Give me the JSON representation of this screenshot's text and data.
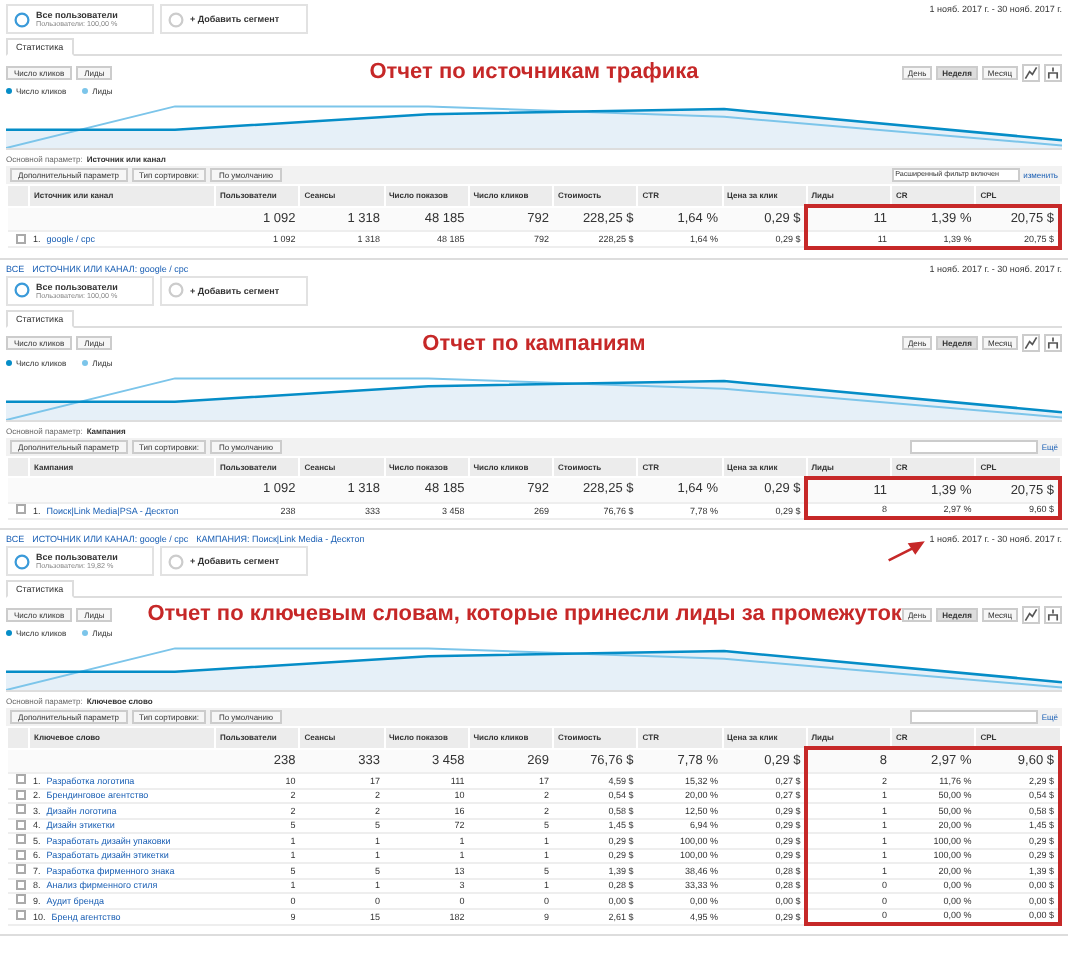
{
  "panels": [
    {
      "segments": [
        {
          "kind": "segment",
          "name": "Все пользователи",
          "sub": "Пользователи: 100,00 %"
        },
        {
          "kind": "add",
          "name": "+ Добавить сегмент"
        }
      ],
      "date": "1 нояб. 2017 г. - 30 нояб. 2017 г.",
      "tabs": [
        {
          "label": "Статистика",
          "selected": true
        }
      ],
      "metrics": [
        "Число кликов",
        "Лиды"
      ],
      "title": "Отчет по источникам трафика",
      "periods": [
        {
          "label": "День",
          "selected": false
        },
        {
          "label": "Неделя",
          "selected": true
        },
        {
          "label": "Месяц",
          "selected": false
        }
      ],
      "legend": [
        {
          "label": "Число кликов",
          "color": "#058dc7"
        },
        {
          "label": "Лиды",
          "color": "#7cc5ea"
        }
      ],
      "primary": {
        "label": "Основной параметр:",
        "value": "Источник или канал"
      },
      "toolbar": [
        "Дополнительный параметр",
        "Тип сортировки:",
        "По умолчанию"
      ],
      "search": {
        "value": "Расширенный фильтр включен"
      },
      "search_link": "изменить",
      "columns": [
        {
          "label": "Источник или канал",
          "highlighted": false
        },
        {
          "label": "Пользователи",
          "highlighted": false
        },
        {
          "label": "Сеансы",
          "highlighted": false
        },
        {
          "label": "Число показов",
          "highlighted": false
        },
        {
          "label": "Число кликов",
          "highlighted": false
        },
        {
          "label": "Стоимость",
          "highlighted": false
        },
        {
          "label": "CTR",
          "highlighted": false
        },
        {
          "label": "Цена за клик",
          "highlighted": false
        },
        {
          "label": "Лиды",
          "highlighted": true
        },
        {
          "label": "CR",
          "highlighted": true
        },
        {
          "label": "CPL",
          "highlighted": true
        }
      ],
      "totals": [
        "1 092",
        "1 318",
        "48 185",
        "792",
        "228,25 $",
        "1,64 %",
        "0,29 $",
        "11",
        "1,39 %",
        "20,75 $"
      ],
      "rows": [
        {
          "number": "1.",
          "checked": false,
          "cells": [
            "google / cpc",
            "1 092",
            "1 318",
            "48 185",
            "792",
            "228,25 $",
            "1,64 %",
            "0,29 $",
            "11",
            "1,39 %",
            "20,75 $"
          ]
        }
      ]
    },
    {
      "breadcrumb": [
        "ВСЕ",
        "ИСТОЧНИК ИЛИ КАНАЛ: google / cpc"
      ],
      "segments": [
        {
          "kind": "segment",
          "name": "Все пользователи",
          "sub": "Пользователи: 100,00 %"
        },
        {
          "kind": "add",
          "name": "+ Добавить сегмент"
        }
      ],
      "date": "1 нояб. 2017 г. - 30 нояб. 2017 г.",
      "tabs": [
        {
          "label": "Статистика",
          "selected": true
        }
      ],
      "metrics": [
        "Число кликов",
        "Лиды"
      ],
      "title": "Отчет по кампаниям",
      "periods": [
        {
          "label": "День",
          "selected": false
        },
        {
          "label": "Неделя",
          "selected": true
        },
        {
          "label": "Месяц",
          "selected": false
        }
      ],
      "legend": [
        {
          "label": "Число кликов",
          "color": "#058dc7"
        },
        {
          "label": "Лиды",
          "color": "#7cc5ea"
        }
      ],
      "primary": {
        "label": "Основной параметр:",
        "value": "Кампания"
      },
      "toolbar": [
        "Дополнительный параметр",
        "Тип сортировки:",
        "По умолчанию"
      ],
      "search_link": "Ещё",
      "columns": [
        {
          "label": "Кампания",
          "highlighted": false
        },
        {
          "label": "Пользователи",
          "highlighted": false
        },
        {
          "label": "Сеансы",
          "highlighted": false
        },
        {
          "label": "Число показов",
          "highlighted": false
        },
        {
          "label": "Число кликов",
          "highlighted": false
        },
        {
          "label": "Стоимость",
          "highlighted": false
        },
        {
          "label": "CTR",
          "highlighted": false
        },
        {
          "label": "Цена за клик",
          "highlighted": false
        },
        {
          "label": "Лиды",
          "highlighted": true
        },
        {
          "label": "CR",
          "highlighted": true
        },
        {
          "label": "CPL",
          "highlighted": true
        }
      ],
      "totals": [
        "1 092",
        "1 318",
        "48 185",
        "792",
        "228,25 $",
        "1,64 %",
        "0,29 $",
        "11",
        "1,39 %",
        "20,75 $"
      ],
      "rows": [
        {
          "number": "1.",
          "checked": false,
          "cells": [
            "Поиск|Link Media|PSA - Десктоп",
            "238",
            "333",
            "3 458",
            "269",
            "76,76 $",
            "7,78 %",
            "0,29 $",
            "8",
            "2,97 %",
            "9,60 $"
          ]
        }
      ]
    },
    {
      "breadcrumb": [
        "ВСЕ",
        "ИСТОЧНИК ИЛИ КАНАЛ: google / cpc",
        "КАМПАНИЯ: Поиск|Link Media - Десктоп"
      ],
      "segments": [
        {
          "kind": "segment",
          "name": "Все пользователи",
          "sub": "Пользователи: 19,82 %"
        },
        {
          "kind": "add",
          "name": "+ Добавить сегмент"
        }
      ],
      "date": "1 нояб. 2017 г. - 30 нояб. 2017 г.",
      "date_arrow": true,
      "tabs": [
        {
          "label": "Статистика",
          "selected": true
        }
      ],
      "metrics": [
        "Число кликов",
        "Лиды"
      ],
      "title": "Отчет по ключевым словам, которые принесли лиды за промежуток",
      "periods": [
        {
          "label": "День",
          "selected": false
        },
        {
          "label": "Неделя",
          "selected": true
        },
        {
          "label": "Месяц",
          "selected": false
        }
      ],
      "legend": [
        {
          "label": "Число кликов",
          "color": "#058dc7"
        },
        {
          "label": "Лиды",
          "color": "#7cc5ea"
        }
      ],
      "primary": {
        "label": "Основной параметр:",
        "value": "Ключевое слово"
      },
      "toolbar": [
        "Дополнительный параметр",
        "Тип сортировки:",
        "По умолчанию"
      ],
      "search_link": "Ещё",
      "columns": [
        {
          "label": "Ключевое слово",
          "highlighted": false
        },
        {
          "label": "Пользователи",
          "highlighted": false
        },
        {
          "label": "Сеансы",
          "highlighted": false
        },
        {
          "label": "Число показов",
          "highlighted": false
        },
        {
          "label": "Число кликов",
          "highlighted": false
        },
        {
          "label": "Стоимость",
          "highlighted": false
        },
        {
          "label": "CTR",
          "highlighted": false
        },
        {
          "label": "Цена за клик",
          "highlighted": false
        },
        {
          "label": "Лиды",
          "highlighted": true
        },
        {
          "label": "CR",
          "highlighted": true
        },
        {
          "label": "CPL",
          "highlighted": true
        }
      ],
      "totals": [
        "238",
        "333",
        "3 458",
        "269",
        "76,76 $",
        "7,78 %",
        "0,29 $",
        "8",
        "2,97 %",
        "9,60 $"
      ],
      "rows": [
        {
          "number": "1.",
          "checked": false,
          "cells": [
            "Разработка логотипа",
            "10",
            "17",
            "111",
            "17",
            "4,59 $",
            "15,32 %",
            "0,27 $",
            "2",
            "11,76 %",
            "2,29 $"
          ]
        },
        {
          "number": "2.",
          "checked": false,
          "cells": [
            "Брендинговое агентство",
            "2",
            "2",
            "10",
            "2",
            "0,54 $",
            "20,00 %",
            "0,27 $",
            "1",
            "50,00 %",
            "0,54 $"
          ]
        },
        {
          "number": "3.",
          "checked": false,
          "cells": [
            "Дизайн логотипа",
            "2",
            "2",
            "16",
            "2",
            "0,58 $",
            "12,50 %",
            "0,29 $",
            "1",
            "50,00 %",
            "0,58 $"
          ]
        },
        {
          "number": "4.",
          "checked": false,
          "cells": [
            "Дизайн этикетки",
            "5",
            "5",
            "72",
            "5",
            "1,45 $",
            "6,94 %",
            "0,29 $",
            "1",
            "20,00 %",
            "1,45 $"
          ]
        },
        {
          "number": "5.",
          "checked": false,
          "cells": [
            "Разработать дизайн упаковки",
            "1",
            "1",
            "1",
            "1",
            "0,29 $",
            "100,00 %",
            "0,29 $",
            "1",
            "100,00 %",
            "0,29 $"
          ]
        },
        {
          "number": "6.",
          "checked": false,
          "cells": [
            "Разработать дизайн этикетки",
            "1",
            "1",
            "1",
            "1",
            "0,29 $",
            "100,00 %",
            "0,29 $",
            "1",
            "100,00 %",
            "0,29 $"
          ]
        },
        {
          "number": "7.",
          "checked": false,
          "cells": [
            "Разработка фирменного знака",
            "5",
            "5",
            "13",
            "5",
            "1,39 $",
            "38,46 %",
            "0,28 $",
            "1",
            "20,00 %",
            "1,39 $"
          ]
        },
        {
          "number": "8.",
          "checked": false,
          "cells": [
            "Анализ фирменного стиля",
            "1",
            "1",
            "3",
            "1",
            "0,28 $",
            "33,33 %",
            "0,28 $",
            "0",
            "0,00 %",
            "0,00 $"
          ]
        },
        {
          "number": "9.",
          "checked": false,
          "cells": [
            "Аудит бренда",
            "0",
            "0",
            "0",
            "0",
            "0,00 $",
            "0,00 %",
            "0,00 $",
            "0",
            "0,00 %",
            "0,00 $"
          ]
        },
        {
          "number": "10.",
          "checked": false,
          "cells": [
            "Бренд агентство",
            "9",
            "15",
            "182",
            "9",
            "2,61 $",
            "4,95 %",
            "0,29 $",
            "0",
            "0,00 %",
            "0,00 $"
          ]
        }
      ]
    }
  ]
}
